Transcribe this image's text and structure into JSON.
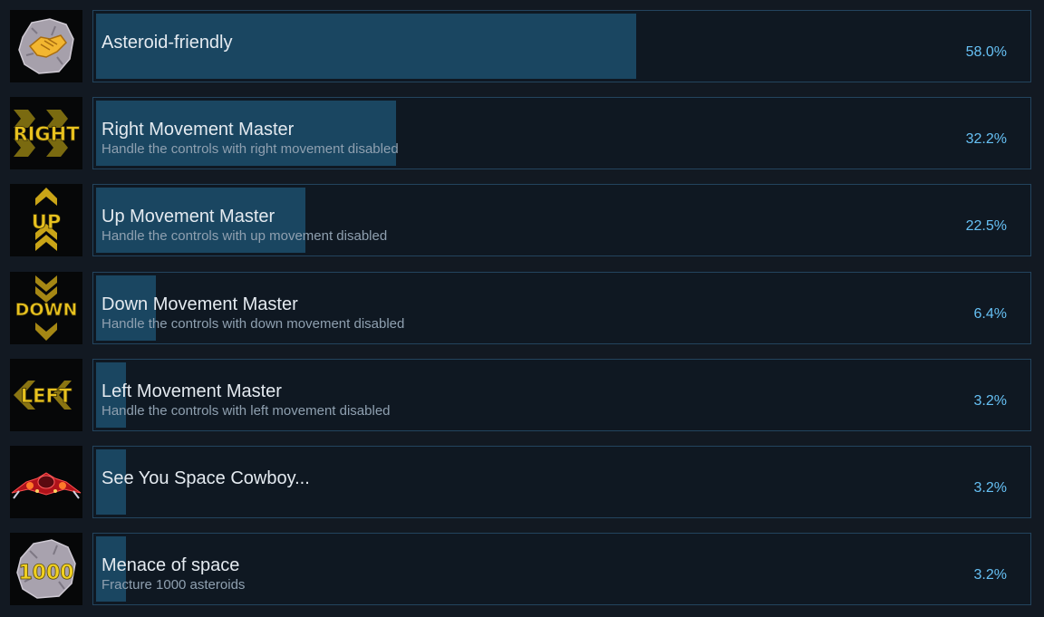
{
  "achievements": [
    {
      "name": "Asteroid-friendly",
      "description": "",
      "percent_label": "58.0%",
      "percent": 58.0,
      "icon": "handshake-asteroid-icon"
    },
    {
      "name": "Right Movement Master",
      "description": "Handle the controls with right movement disabled",
      "percent_label": "32.2%",
      "percent": 32.2,
      "icon": "right-arrows-icon",
      "icon_text": "RIGHT"
    },
    {
      "name": "Up Movement Master",
      "description": "Handle the controls with up movement disabled",
      "percent_label": "22.5%",
      "percent": 22.5,
      "icon": "up-arrows-icon",
      "icon_text": "UP"
    },
    {
      "name": "Down Movement Master",
      "description": "Handle the controls with down movement disabled",
      "percent_label": "6.4%",
      "percent": 6.4,
      "icon": "down-arrows-icon",
      "icon_text": "DOWN"
    },
    {
      "name": "Left Movement Master",
      "description": "Handle the controls with left movement disabled",
      "percent_label": "3.2%",
      "percent": 3.2,
      "icon": "left-arrows-icon",
      "icon_text": "LEFT"
    },
    {
      "name": "See You Space Cowboy...",
      "description": "",
      "percent_label": "3.2%",
      "percent": 3.2,
      "icon": "spaceship-icon"
    },
    {
      "name": "Menace of space",
      "description": "Fracture 1000 asteroids",
      "percent_label": "3.2%",
      "percent": 3.2,
      "icon": "asteroid-1000-icon",
      "icon_text": "1000"
    }
  ],
  "colors": {
    "background": "#121922",
    "bar_fill": "#1a4661",
    "panel_border": "#23445e",
    "percent_text": "#66c0f4",
    "icon_gold": "#e8c21f"
  }
}
